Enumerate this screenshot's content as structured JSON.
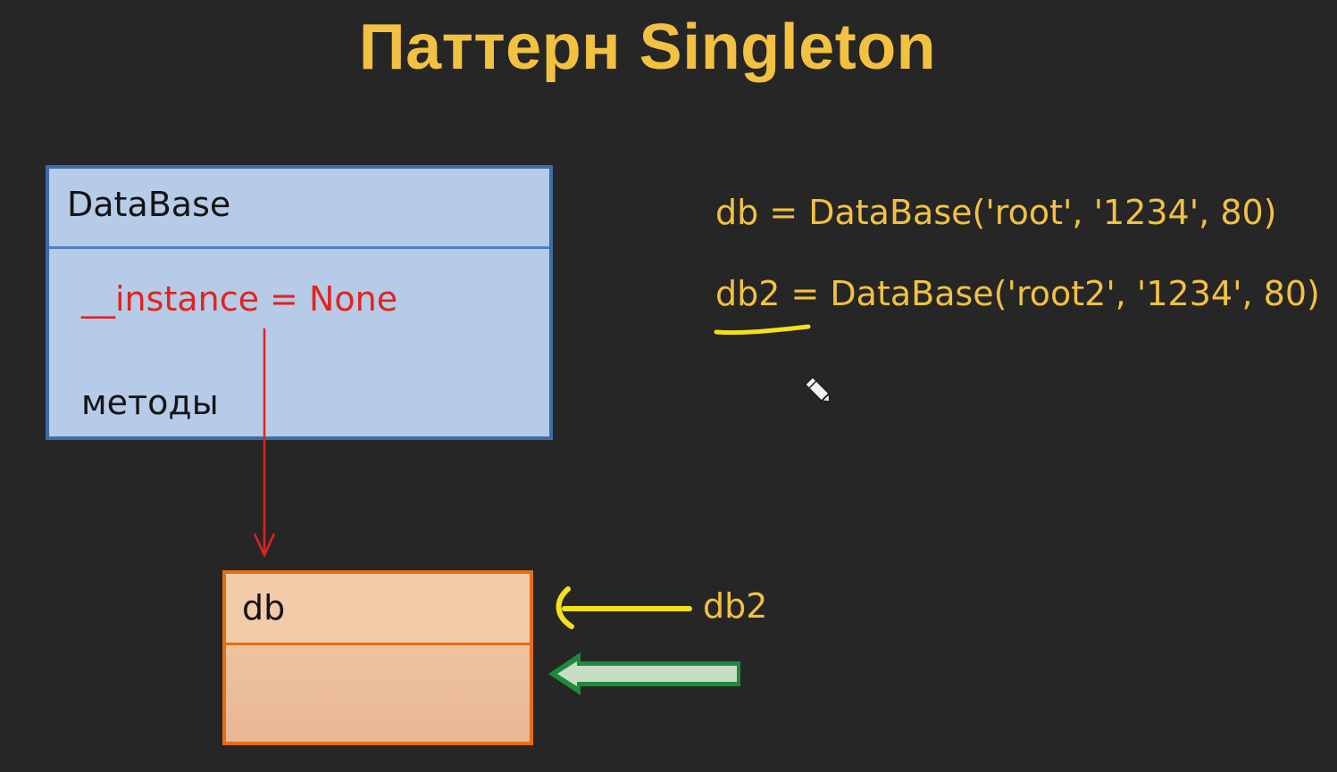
{
  "title": "Паттерн Singleton",
  "class_box": {
    "name": "DataBase",
    "attribute": "__instance = None",
    "methods": "методы"
  },
  "object_box": {
    "name": "db"
  },
  "code": {
    "line1": "db = DataBase('root', '1234', 80)",
    "line2": "db2 = DataBase('root2', '1234', 80)"
  },
  "pointer_label": "db2",
  "colors": {
    "background": "#262626",
    "title": "#f2c141",
    "code": "#f2c141",
    "class_fill": "#b6cbe7",
    "class_border": "#3f6ba8",
    "attribute": "#e02420",
    "object_fill": "#f5cba7",
    "object_border": "#e46e14",
    "reference_arrow": "#e02420",
    "db2_arrow": "#f5e11a",
    "db_arrow": "#1e8a3c"
  },
  "icons": {
    "cursor": "pen-cursor-icon"
  }
}
